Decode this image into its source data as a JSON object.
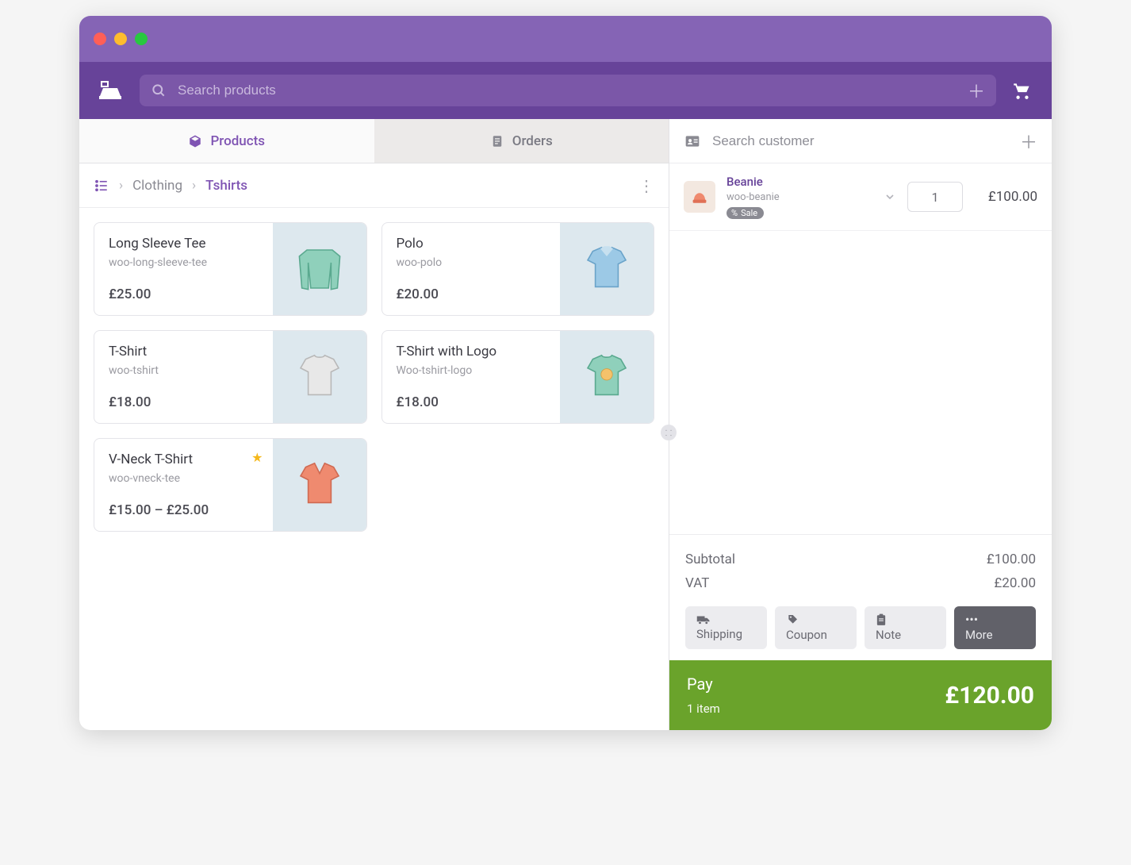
{
  "colors": {
    "accent": "#7f54b3",
    "pay": "#6aa32b"
  },
  "search": {
    "placeholder": "Search products"
  },
  "tabs": {
    "products": "Products",
    "orders": "Orders"
  },
  "breadcrumb": {
    "parent": "Clothing",
    "current": "Tshirts"
  },
  "products": [
    {
      "name": "Long Sleeve Tee",
      "sku": "woo-long-sleeve-tee",
      "price": "£25.00",
      "featured": false,
      "img": "longsleeve"
    },
    {
      "name": "Polo",
      "sku": "woo-polo",
      "price": "£20.00",
      "featured": false,
      "img": "polo"
    },
    {
      "name": "T-Shirt",
      "sku": "woo-tshirt",
      "price": "£18.00",
      "featured": false,
      "img": "tshirt"
    },
    {
      "name": "T-Shirt with Logo",
      "sku": "Woo-tshirt-logo",
      "price": "£18.00",
      "featured": false,
      "img": "logotee"
    },
    {
      "name": "V-Neck T-Shirt",
      "sku": "woo-vneck-tee",
      "price": "£15.00 – £25.00",
      "featured": true,
      "img": "vneck"
    }
  ],
  "customer": {
    "placeholder": "Search customer"
  },
  "cart": {
    "lines": [
      {
        "name": "Beanie",
        "sku": "woo-beanie",
        "badge": "Sale",
        "qty": "1",
        "price": "£100.00"
      }
    ]
  },
  "totals": {
    "subtotal_label": "Subtotal",
    "subtotal": "£100.00",
    "vat_label": "VAT",
    "vat": "£20.00"
  },
  "actions": {
    "shipping": "Shipping",
    "coupon": "Coupon",
    "note": "Note",
    "more": "More"
  },
  "pay": {
    "label": "Pay",
    "items": "1 item",
    "amount": "£120.00"
  }
}
